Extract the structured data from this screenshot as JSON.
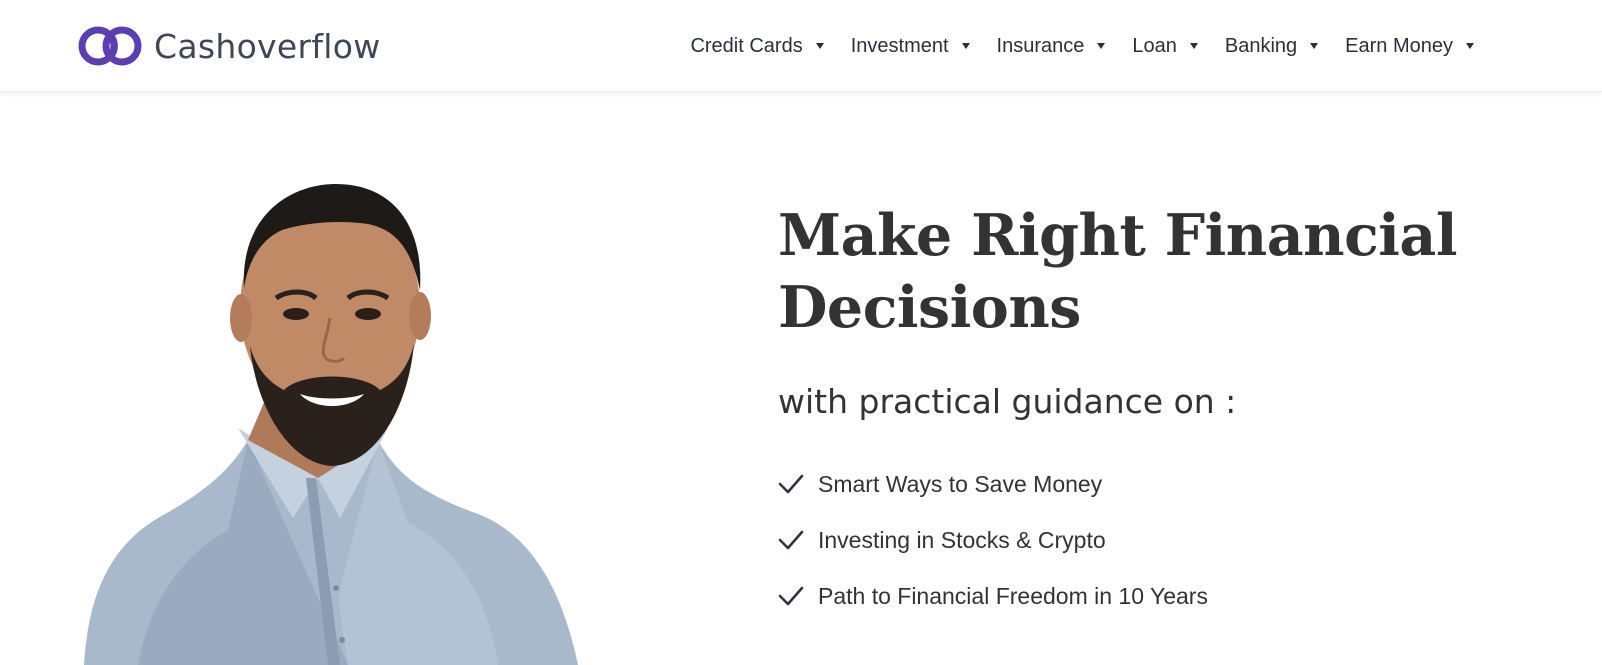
{
  "brand": {
    "name": "Cashoverflow",
    "logo_icon": "interlocked-rings-logo",
    "accent_color": "#5b3fb0"
  },
  "nav": {
    "items": [
      {
        "label": "Credit Cards",
        "icon": "chevron-down-icon"
      },
      {
        "label": "Investment",
        "icon": "chevron-down-icon"
      },
      {
        "label": "Insurance",
        "icon": "chevron-down-icon"
      },
      {
        "label": "Loan",
        "icon": "chevron-down-icon"
      },
      {
        "label": "Banking",
        "icon": "chevron-down-icon"
      },
      {
        "label": "Earn Money",
        "icon": "chevron-down-icon"
      }
    ]
  },
  "hero": {
    "title_line1": "Make Right Financial",
    "title_line2": "Decisions",
    "subtitle": "with practical guidance on :",
    "photo_subject": "smiling man in light blue shirt",
    "benefits": [
      {
        "text": "Smart Ways to Save Money",
        "icon": "checkmark-icon"
      },
      {
        "text": "Investing in Stocks & Crypto",
        "icon": "checkmark-icon"
      },
      {
        "text": "Path to Financial Freedom in 10 Years",
        "icon": "checkmark-icon"
      }
    ]
  },
  "colors": {
    "text_primary": "#333333",
    "nav_text": "#2b2f3a",
    "background": "#ffffff"
  }
}
